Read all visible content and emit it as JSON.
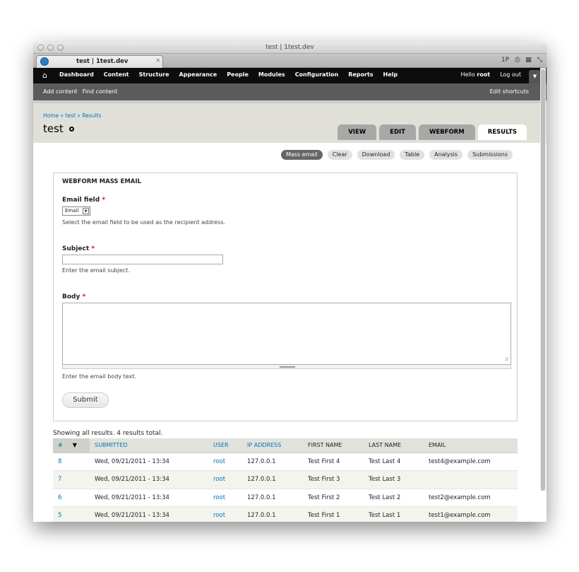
{
  "window": {
    "title": "test | 1test.dev",
    "tab_label": "test | 1test.dev",
    "tab_close": "×",
    "tools": [
      "1P",
      "⎙",
      "▦",
      "⤡"
    ]
  },
  "toolbar": {
    "home_icon": "⌂",
    "menu": [
      "Dashboard",
      "Content",
      "Structure",
      "Appearance",
      "People",
      "Modules",
      "Configuration",
      "Reports",
      "Help"
    ],
    "hello": "Hello",
    "username": "root",
    "logout": "Log out",
    "drop_icon": "▼"
  },
  "shortcuts": {
    "items": [
      "Add content",
      "Find content"
    ],
    "edit": "Edit shortcuts"
  },
  "breadcrumb": [
    "Home",
    "»",
    "test",
    "»",
    "Results"
  ],
  "page_title": "test",
  "primary_tabs": [
    {
      "label": "VIEW",
      "active": false
    },
    {
      "label": "EDIT",
      "active": false
    },
    {
      "label": "WEBFORM",
      "active": false
    },
    {
      "label": "RESULTS",
      "active": true
    }
  ],
  "secondary_tabs": [
    {
      "label": "Mass email",
      "active": true
    },
    {
      "label": "Clear",
      "active": false
    },
    {
      "label": "Download",
      "active": false
    },
    {
      "label": "Table",
      "active": false
    },
    {
      "label": "Analysis",
      "active": false
    },
    {
      "label": "Submissions",
      "active": false
    }
  ],
  "form": {
    "legend": "WEBFORM MASS EMAIL",
    "email_field_label": "Email field",
    "required_mark": "*",
    "email_field_value": "Email",
    "email_field_desc": "Select the email field to be used as the recipient address.",
    "subject_label": "Subject",
    "subject_desc": "Enter the email subject.",
    "body_label": "Body",
    "body_desc": "Enter the email body text.",
    "submit_label": "Submit"
  },
  "results": {
    "summary": "Showing all results. 4 results total.",
    "columns": [
      "#",
      "SUBMITTED",
      "USER",
      "IP ADDRESS",
      "FIRST NAME",
      "LAST NAME",
      "EMAIL"
    ],
    "sort_icon": "▼",
    "rows": [
      [
        "8",
        "Wed, 09/21/2011 - 13:34",
        "root",
        "127.0.0.1",
        "Test First 4",
        "Test Last 4",
        "test4@example.com"
      ],
      [
        "7",
        "Wed, 09/21/2011 - 13:34",
        "root",
        "127.0.0.1",
        "Test First 3",
        "Test Last 3",
        ""
      ],
      [
        "6",
        "Wed, 09/21/2011 - 13:34",
        "root",
        "127.0.0.1",
        "Test First 2",
        "Test Last 2",
        "test2@example.com"
      ],
      [
        "5",
        "Wed, 09/21/2011 - 13:34",
        "root",
        "127.0.0.1",
        "Test First 1",
        "Test Last 1",
        "test1@example.com"
      ]
    ]
  }
}
